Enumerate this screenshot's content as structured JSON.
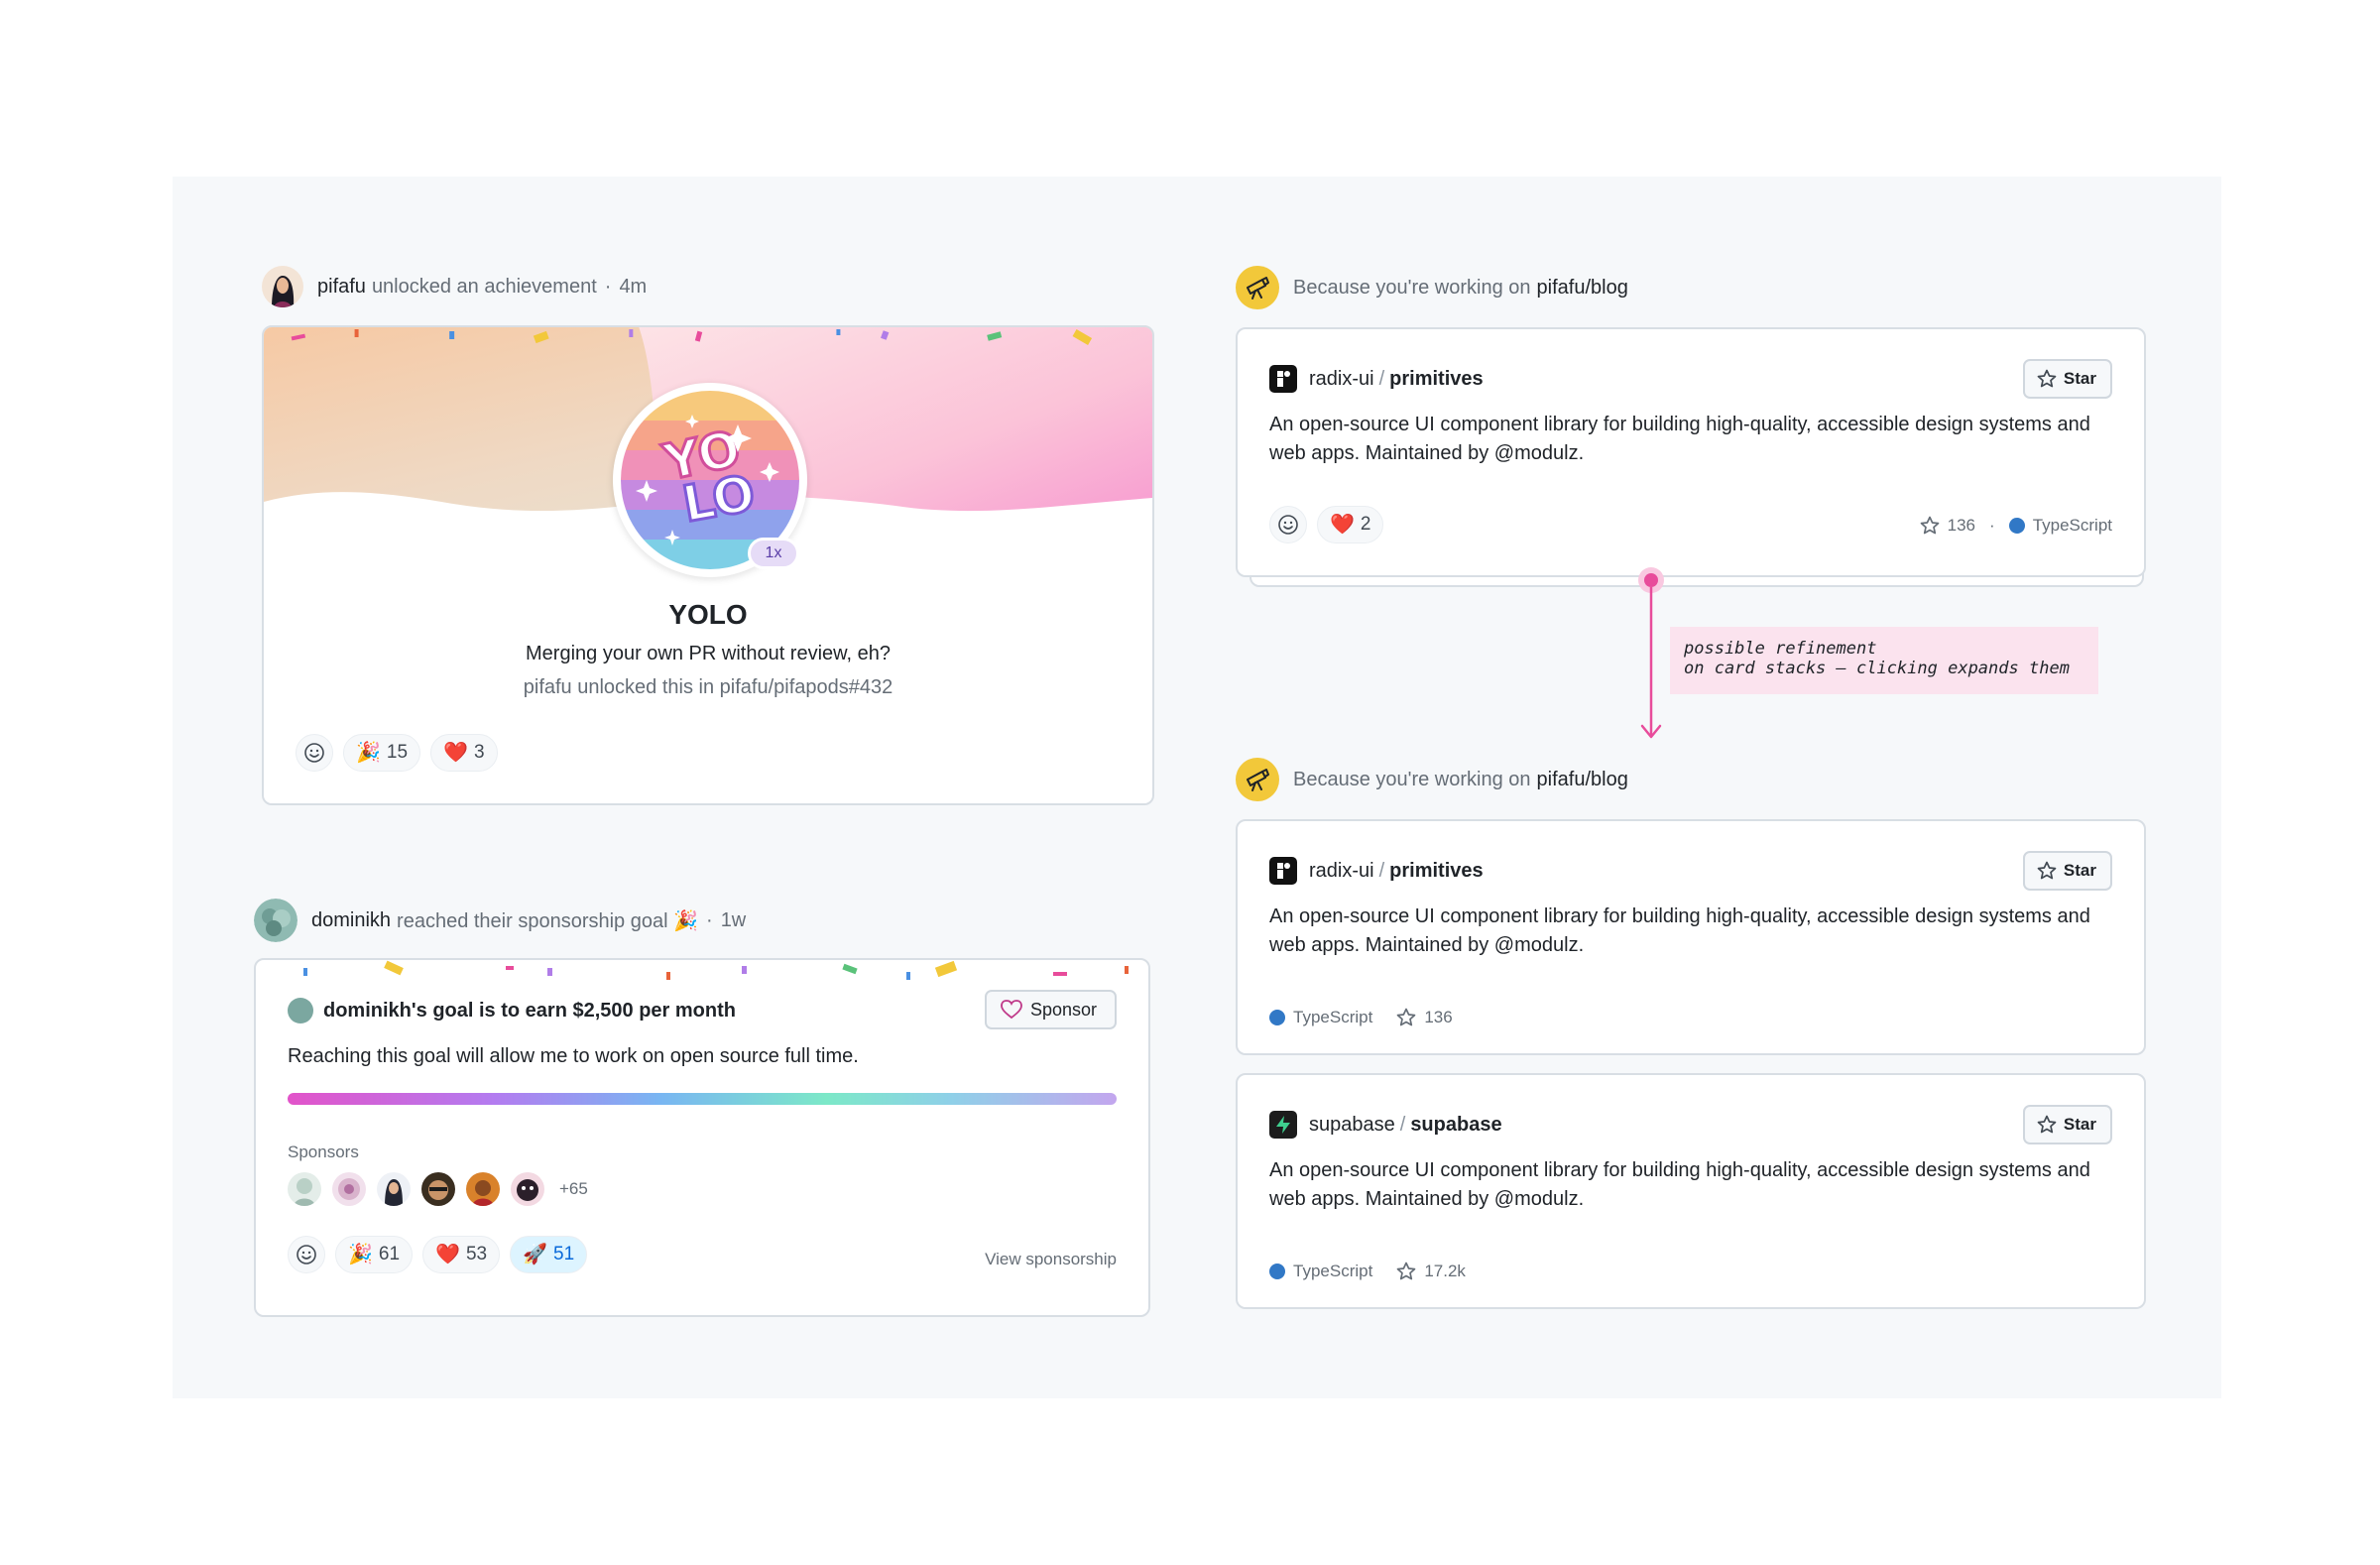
{
  "colors": {
    "canvas_bg": "#f6f8fa",
    "accent_pink": "#e84c9b",
    "typescript_blue": "#3178c6",
    "telescope_yellow": "#f2c83a"
  },
  "achievement_event": {
    "user": "pifafu",
    "action": "unlocked an achievement",
    "time": "4m",
    "badge_count": "1x",
    "title": "YOLO",
    "description": "Merging your own PR without review, eh?",
    "subtext": "pifafu unlocked this in pifafu/pifapods#432",
    "reactions": [
      {
        "emoji": "🎉",
        "count": "15"
      },
      {
        "emoji": "❤️",
        "count": "3"
      }
    ]
  },
  "sponsor_event": {
    "user": "dominikh",
    "action": "reached their sponsorship goal 🎉",
    "time": "1w",
    "goal_text": "dominikh's goal is to earn $2,500 per month",
    "sponsor_label": "Sponsor",
    "description": "Reaching this goal will allow me to work on open source full time.",
    "sponsors_label": "Sponsors",
    "sponsors_more": "+65",
    "progress_fraction": 1.0,
    "reactions": [
      {
        "emoji": "🎉",
        "count": "61"
      },
      {
        "emoji": "❤️",
        "count": "53"
      },
      {
        "emoji": "🚀",
        "count": "51"
      }
    ],
    "view_link": "View sponsorship"
  },
  "recommendation_1": {
    "prefix": "Because you're working on",
    "repo_context": "pifafu/blog",
    "card": {
      "owner": "radix-ui",
      "name": "primitives",
      "star_label": "Star",
      "description": "An open-source UI component library for building high-quality, accessible design systems and web apps. Maintained by @modulz.",
      "reaction_heart": "❤️",
      "reaction_count": "2",
      "stars": "136",
      "meta_sep": "·",
      "language": "TypeScript"
    }
  },
  "annotation": {
    "text": "possible refinement\non card stacks — clicking expands them"
  },
  "recommendation_2": {
    "prefix": "Because you're working on",
    "repo_context": "pifafu/blog",
    "cards": [
      {
        "owner": "radix-ui",
        "name": "primitives",
        "star_label": "Star",
        "description": "An open-source UI component library for building high-quality, accessible design systems and web apps. Maintained by @modulz.",
        "language": "TypeScript",
        "stars": "136"
      },
      {
        "owner": "supabase",
        "name": "supabase",
        "star_label": "Star",
        "description": "An open-source UI component library for building high-quality, accessible design systems and web apps. Maintained by @modulz.",
        "language": "TypeScript",
        "stars": "17.2k"
      }
    ]
  }
}
